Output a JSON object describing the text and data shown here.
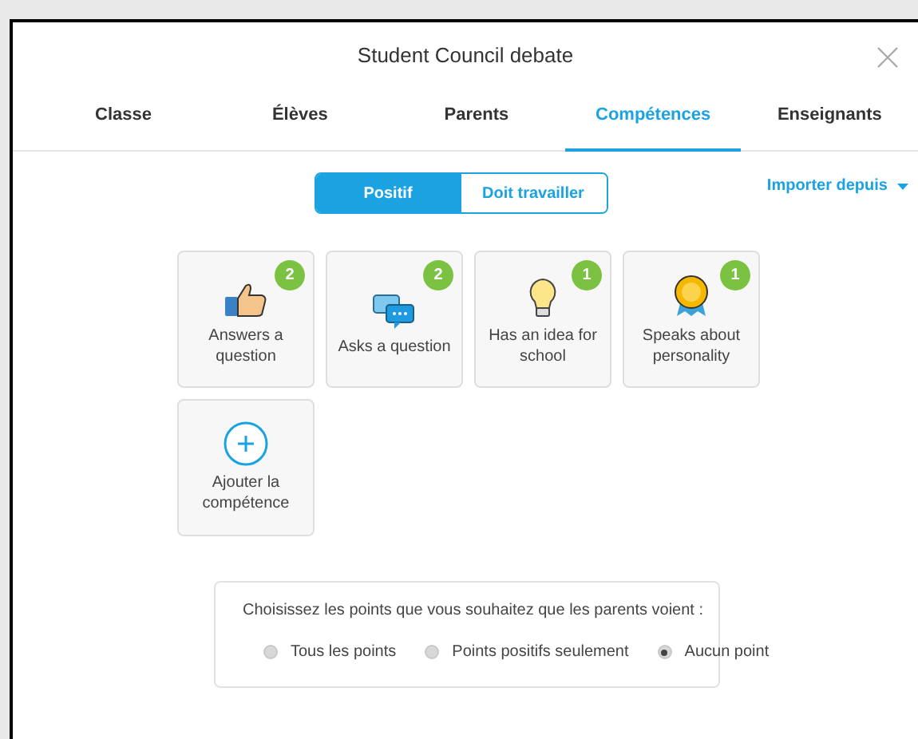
{
  "dialog": {
    "title": "Student Council debate"
  },
  "tabs": [
    {
      "label": "Classe",
      "selected": false
    },
    {
      "label": "Élèves",
      "selected": false
    },
    {
      "label": "Parents",
      "selected": false
    },
    {
      "label": "Compétences",
      "selected": true
    },
    {
      "label": "Enseignants",
      "selected": false
    }
  ],
  "segments": [
    {
      "label": "Positif",
      "selected": true
    },
    {
      "label": "Doit travailler",
      "selected": false
    }
  ],
  "import_menu": {
    "label": "Importer depuis"
  },
  "skills": [
    {
      "kind": "skill",
      "label": "Answers a question",
      "count": "2"
    },
    {
      "kind": "skill",
      "label": "Asks a question",
      "count": "2"
    },
    {
      "kind": "skill",
      "label": "Has an idea for school",
      "count": "1"
    },
    {
      "kind": "skill",
      "label": "Speaks about personality",
      "count": "1"
    },
    {
      "kind": "add",
      "label": "Ajouter la compétence"
    }
  ],
  "visibility": {
    "prompt": "Choisissez les points que vous souhaitez que les parents voient :",
    "options": [
      {
        "label": "Tous les points",
        "selected": false
      },
      {
        "label": "Points positifs seulement",
        "selected": false
      },
      {
        "label": "Aucun point",
        "selected": true
      }
    ]
  }
}
